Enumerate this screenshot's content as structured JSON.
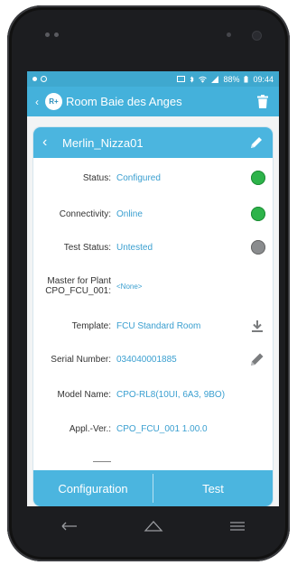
{
  "status_bar": {
    "left_icons": [
      "notification-dot-icon",
      "circle-icon"
    ],
    "battery": "88%",
    "time": "09:44"
  },
  "app_bar": {
    "title": "Room Baie des Anges",
    "logo_text": "R+"
  },
  "device": {
    "name": "Merlin_Nizza01",
    "rows": [
      {
        "label": "Status:",
        "value": "Configured",
        "indicator": "green"
      },
      {
        "label": "Connectivity:",
        "value": "Online",
        "indicator": "green"
      },
      {
        "label": "Test Status:",
        "value": "Untested",
        "indicator": "grey"
      },
      {
        "label": "Master for Plant CPO_FCU_001:",
        "value": "<None>"
      },
      {
        "label": "Template:",
        "value": "FCU Standard Room",
        "action": "download-icon"
      },
      {
        "label": "Serial Number:",
        "value": "034040001885",
        "action": "pencil-icon"
      },
      {
        "label": "Model Name:",
        "value": "CPO-RL8(10UI, 6A3, 9BO)"
      },
      {
        "label": "Appl.-Ver.:",
        "value": "CPO_FCU_001 1.00.0"
      }
    ]
  },
  "buttons": {
    "configuration": "Configuration",
    "test": "Test"
  },
  "colors": {
    "accent": "#44b1db",
    "value_text": "#3a9fd0",
    "green": "#2db34a",
    "grey": "#8a8c8e"
  }
}
